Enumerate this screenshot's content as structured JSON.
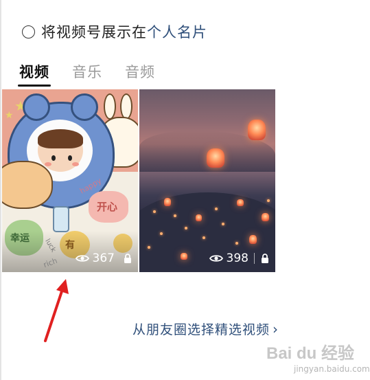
{
  "profile_option": {
    "text": "将视频号展示在",
    "link": "个人名片",
    "checked": false
  },
  "tabs": [
    {
      "label": "视频",
      "active": true
    },
    {
      "label": "音乐",
      "active": false
    },
    {
      "label": "音频",
      "active": false
    }
  ],
  "videos": [
    {
      "views": "367",
      "locked": true,
      "thumbnail": "cartoon-illustration"
    },
    {
      "views": "398",
      "locked": true,
      "thumbnail": "sky-lanterns-night"
    }
  ],
  "footer": {
    "link": "从朋友圈选择精选视频",
    "chevron": "›"
  },
  "thumbnail_text": {
    "heart": "开心",
    "apple": "幸运",
    "coin": "有",
    "happy": "happy",
    "luck": "luck",
    "rich": "rich"
  },
  "watermark": {
    "logo": "Bai du 经验",
    "sub": "jingyan.baidu.com"
  },
  "colors": {
    "link": "#2f4f7a",
    "active_tab": "#111111",
    "inactive_tab": "#9a9a9a",
    "annotation": "#e02020"
  },
  "icons": [
    "radio-icon",
    "eye-icon",
    "lock-icon",
    "chevron-right-icon",
    "red-arrow-annotation"
  ]
}
